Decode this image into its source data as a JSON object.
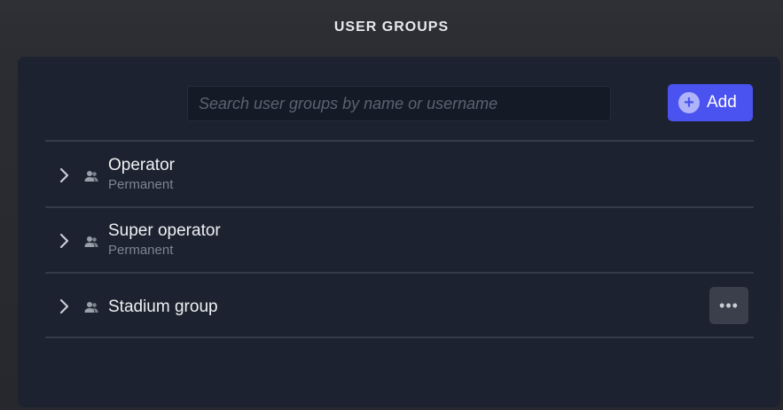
{
  "header": {
    "title": "USER GROUPS"
  },
  "toolbar": {
    "search_placeholder": "Search user groups by name or username",
    "search_value": "",
    "add_label": "Add",
    "add_icon": "plus-circle-icon"
  },
  "groups": [
    {
      "name": "Operator",
      "subtitle": "Permanent",
      "icon": "user-group-icon",
      "expander": "chevron-right-icon"
    },
    {
      "name": "Super operator",
      "subtitle": "Permanent",
      "icon": "user-group-icon",
      "expander": "chevron-right-icon"
    },
    {
      "name": "Stadium group",
      "subtitle": "",
      "icon": "user-group-icon",
      "expander": "chevron-right-icon",
      "more_label": "•••"
    }
  ],
  "colors": {
    "accent": "#4a52f0",
    "panel": "#1c222f",
    "background": "#2a2c33"
  }
}
